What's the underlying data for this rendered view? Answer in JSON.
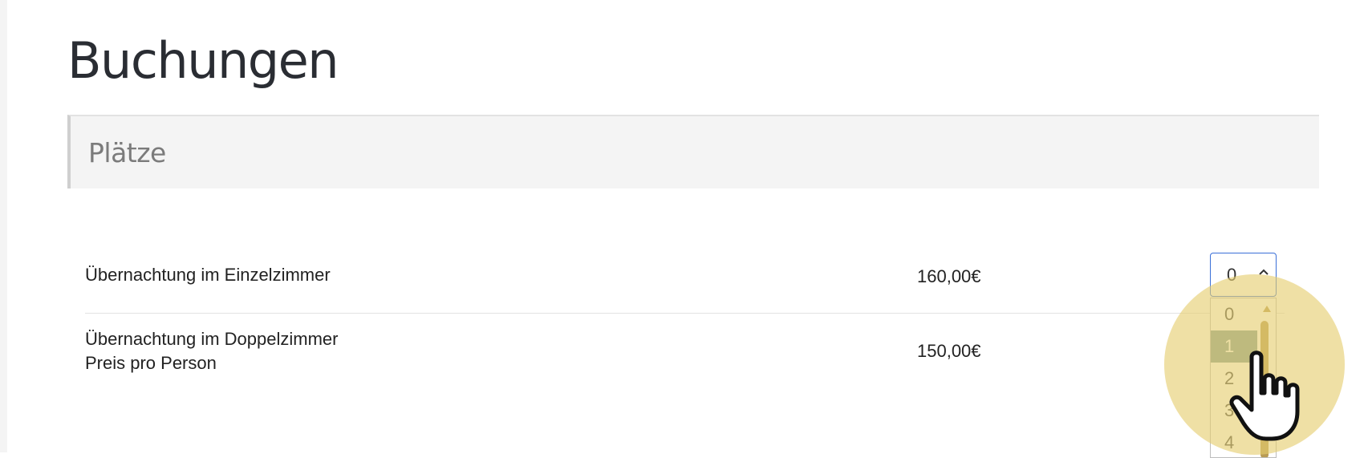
{
  "page": {
    "title": "Buchungen"
  },
  "section": {
    "title": "Plätze"
  },
  "items": [
    {
      "name": "Übernachtung im Einzelzimmer",
      "sub": "",
      "price": "160,00€",
      "quantity": "0"
    },
    {
      "name": "Übernachtung im Doppelzimmer",
      "sub": "Preis pro Person",
      "price": "150,00€"
    }
  ],
  "dropdown": {
    "options": [
      "0",
      "1",
      "2",
      "3",
      "4"
    ],
    "selected_option": "1",
    "state": "open"
  },
  "colors": {
    "select_border": "#3a6fd8",
    "option_selected_bg": "#7f9c9a",
    "highlight": "#e5cd6e",
    "scrollbar": "#b89b54"
  },
  "icons": {
    "select_arrow": "chevron-up-icon",
    "cursor": "hand-pointer-icon"
  }
}
